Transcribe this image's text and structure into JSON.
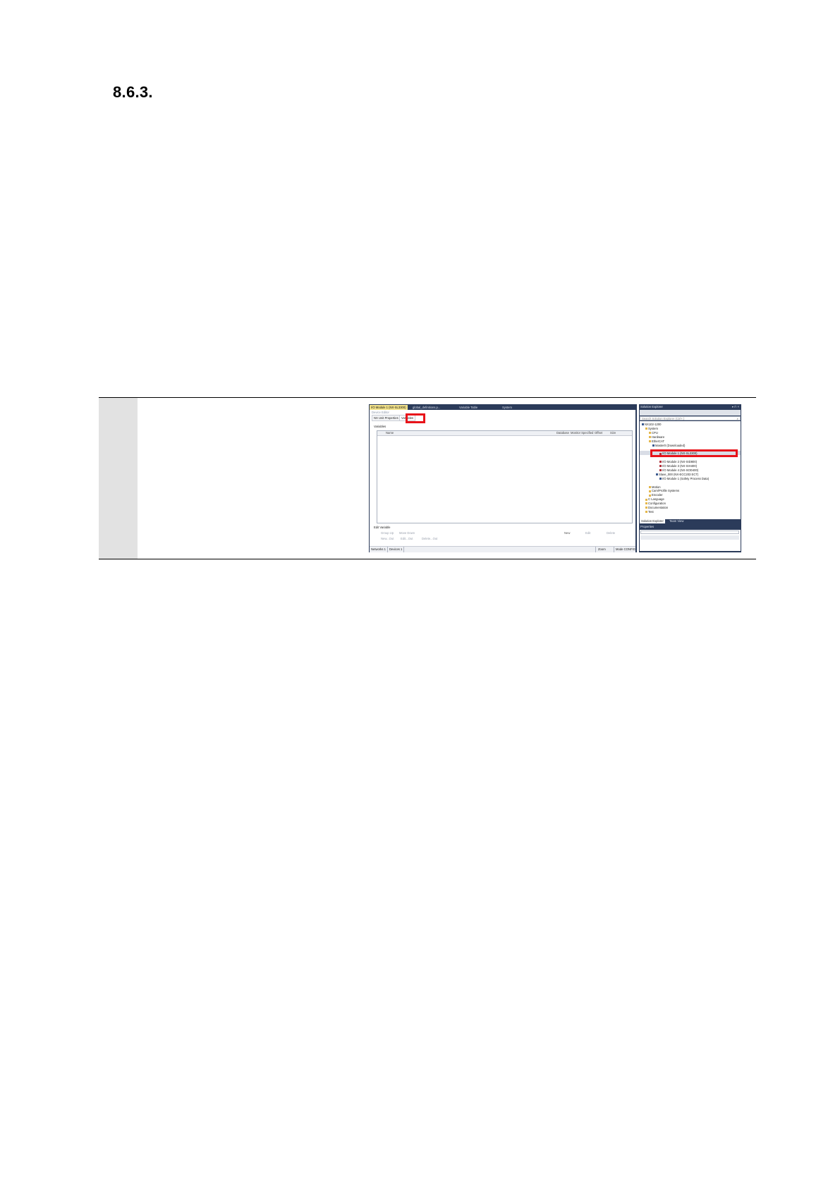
{
  "heading": "8.6.3.",
  "screenshot": {
    "editor": {
      "tabs": [
        "I/O Module 1 (NX-SL3300)",
        "global_definitions.p...",
        "Variable Table",
        "System"
      ],
      "subtitle": "Device Editor",
      "subtabs": [
        "NX Unit Properties",
        "Variables"
      ],
      "section_label": "Variables",
      "grid_columns": [
        "Name",
        "Database",
        "Monitor Specified",
        "Offset",
        "Size"
      ],
      "edit_label": "Edit Variable",
      "actions_row1": [
        "Group Up",
        "Move Down",
        "New",
        "Edit",
        "Delete"
      ],
      "actions_row2": [
        "New...Out",
        "Edit...Out",
        "Delete...Out"
      ],
      "status": [
        "Networks 1",
        "Devices 1",
        "Zoom",
        "Mode CONFIG"
      ]
    },
    "solution_explorer": {
      "title": "Solution Explorer",
      "window_buttons": "▾ ⊓ ×",
      "search_placeholder": "Search Solution Explorer (Ctrl+;)",
      "search_icon": "search-icon",
      "tree": [
        {
          "label": "NX102-1200",
          "level": 0,
          "kind": "device"
        },
        {
          "label": "System",
          "level": 1,
          "kind": "folder"
        },
        {
          "label": "CPU",
          "level": 2,
          "kind": "folder"
        },
        {
          "label": "Hardware",
          "level": 2,
          "kind": "folder"
        },
        {
          "label": "EtherCAT",
          "level": 2,
          "kind": "folder"
        },
        {
          "label": "Master0 (Downloaded)",
          "level": 3,
          "kind": "device"
        },
        {
          "label": "",
          "level": 4,
          "kind": "none"
        },
        {
          "label": "I/O Module 1 (NX-SL3300)",
          "level": 5,
          "kind": "devred"
        },
        {
          "label": "",
          "level": 4,
          "kind": "none"
        },
        {
          "label": "I/O Module 2 (NX-SID800)",
          "level": 5,
          "kind": "devred"
        },
        {
          "label": "I/O Module 3 (NX-SIH400)",
          "level": 5,
          "kind": "devred"
        },
        {
          "label": "I/O Module 4 (NX-SOD400)",
          "level": 5,
          "kind": "devred"
        },
        {
          "label": "Slave_000 (NX-ECC203 ECT)",
          "level": 4,
          "kind": "device"
        },
        {
          "label": "I/O Module 1 (Safety Process Data)",
          "level": 5,
          "kind": "device"
        },
        {
          "label": "",
          "level": 4,
          "kind": "none"
        },
        {
          "label": "Motion",
          "level": 2,
          "kind": "folder"
        },
        {
          "label": "Cam/Profile Systems",
          "level": 2,
          "kind": "folder"
        },
        {
          "label": "Encoder",
          "level": 2,
          "kind": "folder"
        },
        {
          "label": "C Language",
          "level": 1,
          "kind": "folder"
        },
        {
          "label": "Configuration",
          "level": 1,
          "kind": "folder"
        },
        {
          "label": "Documentation",
          "level": 1,
          "kind": "folder"
        },
        {
          "label": "Test",
          "level": 1,
          "kind": "folder"
        }
      ],
      "bottom_tabs": [
        "Solution Explorer",
        "Team View"
      ],
      "properties_title": "Properties",
      "properties_buttons": "▾ ⊓ ×"
    }
  },
  "colors": {
    "callout": "#e8131a",
    "ide_chrome": "#2b3b5a",
    "active_tab": "#f2e28a",
    "step_cell": "#e2e2e2"
  }
}
